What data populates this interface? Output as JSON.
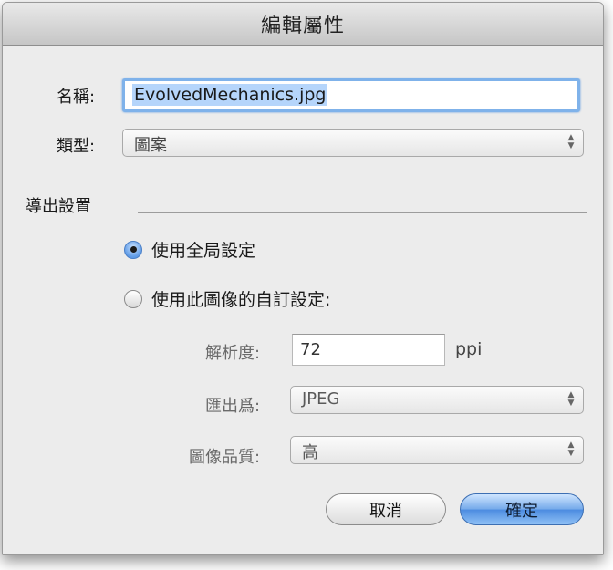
{
  "dialog": {
    "title": "編輯屬性"
  },
  "name": {
    "label": "名稱:",
    "value": "EvolvedMechanics.jpg"
  },
  "type": {
    "label": "類型:",
    "value": "圖案"
  },
  "export": {
    "section_label": "導出設置",
    "options": [
      {
        "label": "使用全局設定",
        "selected": true
      },
      {
        "label": "使用此圖像的自訂設定:",
        "selected": false
      }
    ],
    "resolution": {
      "label": "解析度:",
      "value": "72",
      "unit": "ppi"
    },
    "format": {
      "label": "匯出爲:",
      "value": "JPEG"
    },
    "quality": {
      "label": "圖像品質:",
      "value": "高"
    }
  },
  "buttons": {
    "cancel": "取消",
    "ok": "確定"
  }
}
